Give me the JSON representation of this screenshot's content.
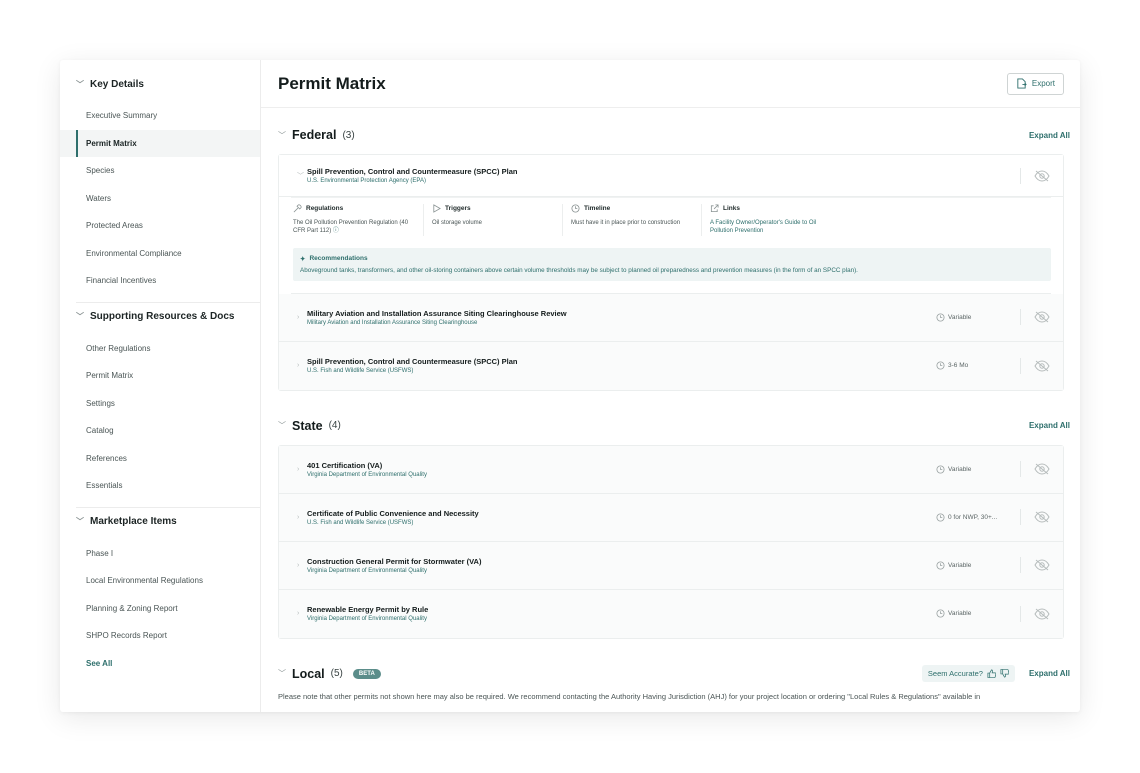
{
  "sidebar": {
    "sections": [
      {
        "title": "Key Details",
        "items": [
          "Executive Summary",
          "Permit Matrix",
          "Species",
          "Waters",
          "Protected Areas",
          "Environmental Compliance",
          "Financial Incentives"
        ]
      },
      {
        "title": "Supporting Resources & Docs",
        "items": [
          "Other Regulations",
          "Permit Matrix",
          "Settings",
          "Catalog",
          "References",
          "Essentials"
        ]
      },
      {
        "title": "Marketplace Items",
        "items": [
          "Phase I",
          "Local Environmental Regulations",
          "Planning & Zoning Report",
          "SHPO Records Report"
        ],
        "see_all": "See All"
      }
    ],
    "active_item": "Permit Matrix"
  },
  "header": {
    "title": "Permit Matrix",
    "export_label": "Export"
  },
  "federal": {
    "title": "Federal",
    "count": "(3)",
    "expand_all": "Expand All",
    "rows": [
      {
        "title": "Spill Prevention, Control and Countermeasure (SPCC) Plan",
        "agency": "U.S. Environmental Protection Agency (EPA)",
        "details": {
          "regulations_label": "Regulations",
          "regulations_text": "The Oil Pollution Prevention Regulation (40 CFR Part 112)",
          "triggers_label": "Triggers",
          "triggers_text": "Oil storage volume",
          "timeline_label": "Timeline",
          "timeline_text": "Must have it in place prior to construction",
          "links_label": "Links",
          "links_text": "A Facility Owner/Operator's Guide to Oil Pollution Prevention",
          "recommendations_label": "Recommendations",
          "recommendations_text": "Aboveground tanks, transformers, and other oil-storing containers above certain volume thresholds may be subject to planned oil preparedness and prevention measures (in the form of an SPCC plan)."
        }
      },
      {
        "title": "Military Aviation and Installation Assurance Siting Clearinghouse Review",
        "agency": "Military Aviation and Installation Assurance Siting Clearinghouse",
        "duration": "Variable"
      },
      {
        "title": "Spill Prevention, Control and Countermeasure (SPCC) Plan",
        "agency": "U.S. Fish and Wildlife Service (USFWS)",
        "duration": "3-6 Mo"
      }
    ]
  },
  "state": {
    "title": "State",
    "count": "(4)",
    "expand_all": "Expand All",
    "rows": [
      {
        "title": "401 Certification (VA)",
        "agency": "Virginia Department of Environmental Quality",
        "duration": "Variable"
      },
      {
        "title": "Certificate of Public Convenience and Necessity",
        "agency": "U.S. Fish and Wildlife Service (USFWS)",
        "duration": "0 for NWP, 30+..."
      },
      {
        "title": "Construction General Permit for Stormwater (VA)",
        "agency": "Virginia Department of Environmental Quality",
        "duration": "Variable"
      },
      {
        "title": "Renewable Energy Permit by Rule",
        "agency": "Virginia Department of Environmental Quality",
        "duration": "Variable"
      }
    ]
  },
  "local": {
    "title": "Local",
    "count": "(5)",
    "badge": "BETA",
    "accurate_label": "Seem Accurate?",
    "expand_all": "Expand All",
    "note": "Please note that other permits not shown here may also be required. We recommend contacting the Authority Having Jurisdiction (AHJ) for your project location  or ordering \"Local Rules & Regulations\" available in"
  },
  "colors": {
    "accent": "#2e6f6c",
    "recommend_bg": "#eef4f4",
    "beta_bg": "#5b8d8a"
  },
  "icons": [
    "chevron-down-icon",
    "chevron-right-icon",
    "export-icon",
    "eye-off-icon",
    "clock-icon",
    "wrench-icon",
    "play-icon",
    "link-icon",
    "info-icon",
    "thumbs-up-icon",
    "thumbs-down-icon",
    "sparkle-icon"
  ]
}
